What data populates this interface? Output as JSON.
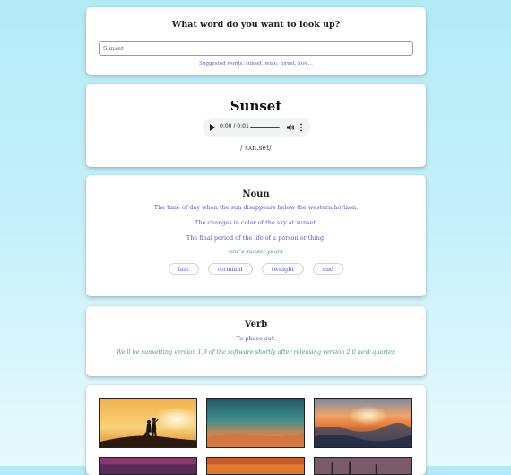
{
  "search": {
    "question": "What word do you want to look up?",
    "value": "Sunset",
    "suggested": "Suggested words: sunset, wine, forest, love..."
  },
  "word": {
    "title": "Sunset",
    "audio_time": "0:00 / 0:01",
    "phonetic": "/ sʌn.set/"
  },
  "noun": {
    "heading": "Noun",
    "definitions": [
      "The time of day when the sun disappears below the western horizon.",
      "The changes in color of the sky at sunset.",
      "The final period of the life of a person or thing."
    ],
    "example": "one's sunset years",
    "synonyms": [
      "last",
      "terminal",
      "twilight",
      "end"
    ]
  },
  "verb": {
    "heading": "Verb",
    "definition": "To phase out.",
    "example": "We'll be sunsetting version 1.9 of the software shortly after releasing version 2.0 next quarter."
  },
  "colors": {
    "accent": "#5b57c9",
    "example": "#4a9a8a",
    "background_top": "#b3eaf7"
  }
}
